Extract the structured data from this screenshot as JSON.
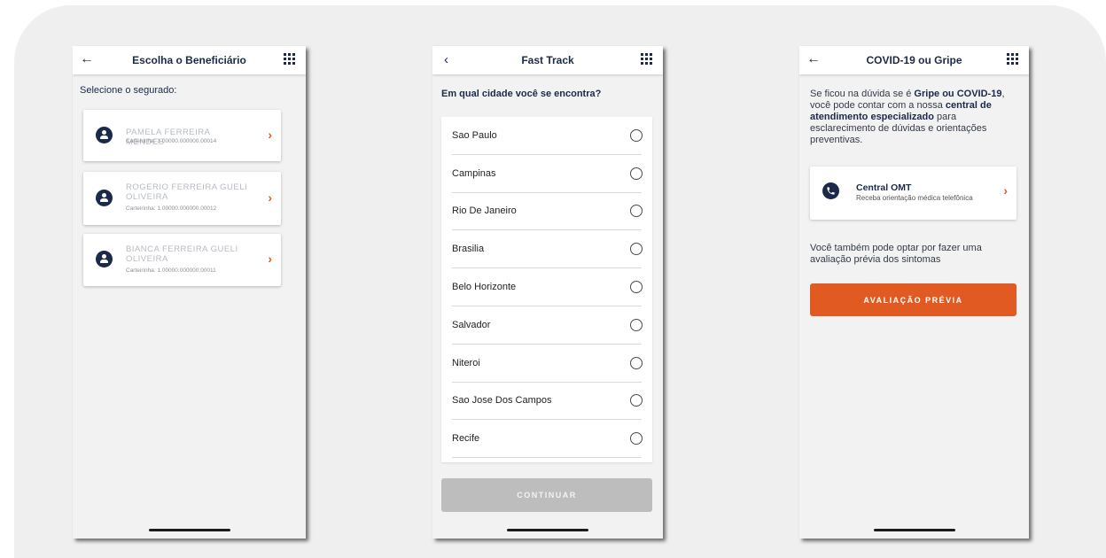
{
  "colors": {
    "primary": "#1b2a4a",
    "accent": "#e05a22",
    "disabled": "#bdbdbd"
  },
  "screen1": {
    "title": "Escolha o Beneficiário",
    "label": "Selecione o segurado:",
    "beneficiaries": [
      {
        "name": "PAMELA FERREIRA MENDES",
        "card": "Carteirinha: 1.00000.000000.00014"
      },
      {
        "name": "ROGERIO FERREIRA GUELI OLIVEIRA",
        "card": "Carteirinha: 1.00000.000000.00012"
      },
      {
        "name": "BIANCA FERREIRA GUELI OLIVEIRA",
        "card": "Carteirinha: 1.00000.000000.00011"
      }
    ]
  },
  "screen2": {
    "title": "Fast Track",
    "question": "Em qual cidade você se encontra?",
    "cities": [
      "Sao Paulo",
      "Campinas",
      "Rio De Janeiro",
      "Brasilia",
      "Belo Horizonte",
      "Salvador",
      "Niteroi",
      "Sao Jose Dos Campos",
      "Recife"
    ],
    "continue_label": "CONTINUAR"
  },
  "screen3": {
    "title": "COVID-19 ou Gripe",
    "intro_1": "Se ficou na dúvida se é ",
    "intro_bold_1": "Gripe ou COVID-19",
    "intro_2": ", você pode contar com a nossa ",
    "intro_bold_2": "central de atendimento especializado",
    "intro_3": " para esclarecimento de dúvidas e orientações preventivas.",
    "omt_title": "Central OMT",
    "omt_sub": "Receba orientação médica telefônica",
    "text2": "Você também pode optar por fazer uma avaliação prévia dos sintomas",
    "button_label": "AVALIAÇÃO PRÉVIA"
  }
}
